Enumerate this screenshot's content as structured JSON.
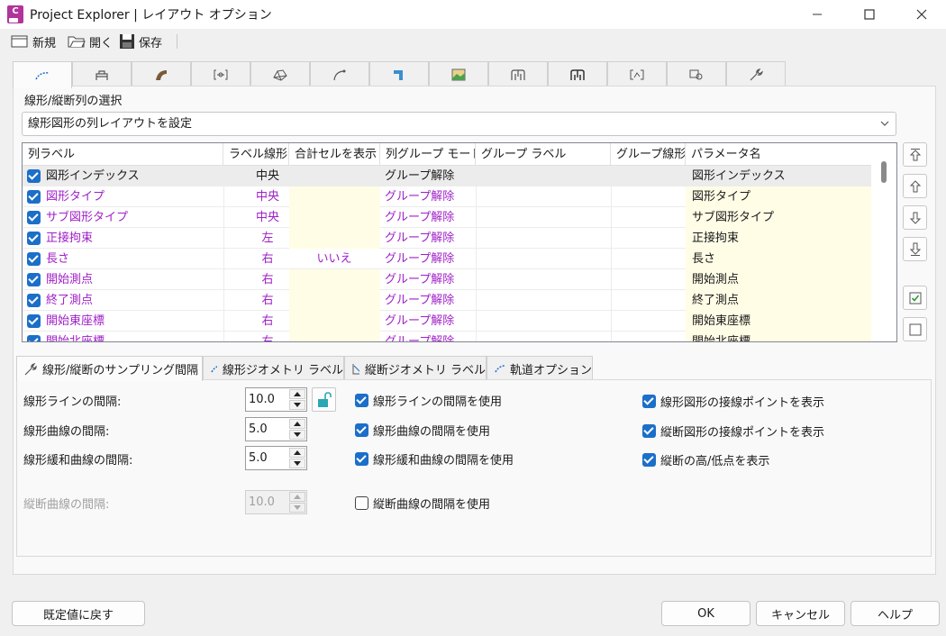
{
  "window": {
    "title": "Project Explorer | レイアウト オプション"
  },
  "toolbar": {
    "new_label": "新規",
    "open_label": "開く",
    "save_label": "保存"
  },
  "selection": {
    "group_label": "線形/縦断列の選択",
    "combo_value": "線形図形の列レイアウトを設定"
  },
  "grid": {
    "headers": [
      "列ラベル",
      "ラベル線形",
      "合計セルを表示",
      "列グループ モード",
      "グループ ラベル",
      "グループ線形",
      "パラメータ名"
    ],
    "rows": [
      {
        "label": "図形インデックス",
        "align": "中央",
        "total": "",
        "mode": "グループ解除",
        "param": "図形インデックス",
        "checked": true
      },
      {
        "label": "図形タイプ",
        "align": "中央",
        "total": "",
        "mode": "グループ解除",
        "param": "図形タイプ",
        "checked": true
      },
      {
        "label": "サブ図形タイプ",
        "align": "中央",
        "total": "",
        "mode": "グループ解除",
        "param": "サブ図形タイプ",
        "checked": true
      },
      {
        "label": "正接拘束",
        "align": "左",
        "total": "",
        "mode": "グループ解除",
        "param": "正接拘束",
        "checked": true
      },
      {
        "label": "長さ",
        "align": "右",
        "total": "いいえ",
        "mode": "グループ解除",
        "param": "長さ",
        "checked": true
      },
      {
        "label": "開始測点",
        "align": "右",
        "total": "",
        "mode": "グループ解除",
        "param": "開始測点",
        "checked": true
      },
      {
        "label": "終了測点",
        "align": "右",
        "total": "",
        "mode": "グループ解除",
        "param": "終了測点",
        "checked": true
      },
      {
        "label": "開始東座標",
        "align": "右",
        "total": "",
        "mode": "グループ解除",
        "param": "開始東座標",
        "checked": true
      },
      {
        "label": "開始北座標",
        "align": "右",
        "total": "",
        "mode": "グループ解除",
        "param": "開始北座標",
        "checked": true
      }
    ]
  },
  "bottom_tabs": [
    "線形/縦断のサンプリング間隔",
    "線形ジオメトリ ラベル",
    "縦断ジオメトリ ラベル",
    "軌道オプション"
  ],
  "sampling": {
    "line_label": "線形ラインの間隔:",
    "line_value": "10.0",
    "curve_label": "線形曲線の間隔:",
    "curve_value": "5.0",
    "spiral_label": "線形緩和曲線の間隔:",
    "spiral_value": "5.0",
    "vcurve_label": "縦断曲線の間隔:",
    "vcurve_value": "10.0"
  },
  "checkboxes": {
    "use_line": "線形ラインの間隔を使用",
    "use_curve": "線形曲線の間隔を使用",
    "use_spiral": "線形緩和曲線の間隔を使用",
    "use_vcurve": "縦断曲線の間隔を使用",
    "show_align_tangent": "線形図形の接線ポイントを表示",
    "show_profile_tangent": "縦断図形の接線ポイントを表示",
    "show_high_low": "縦断の高/低点を表示"
  },
  "buttons": {
    "reset": "既定値に戻す",
    "ok": "OK",
    "cancel": "キャンセル",
    "help": "ヘルプ"
  },
  "colors": {
    "accent": "#1b6fc9",
    "purple_text": "#a020c8",
    "yellow_cell": "#fffde6"
  }
}
